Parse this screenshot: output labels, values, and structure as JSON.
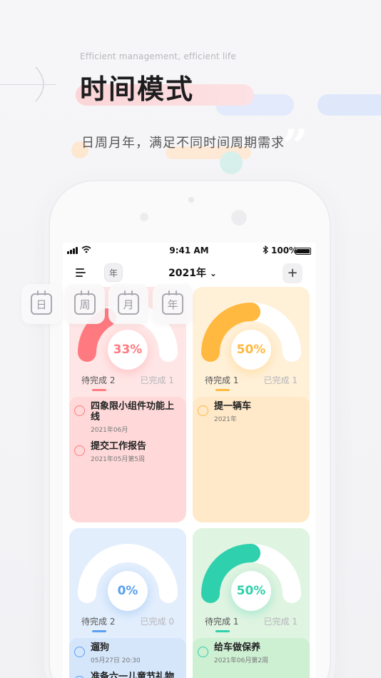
{
  "header": {
    "tagline": "Efficient management, efficient life",
    "title": "时间模式",
    "subtitle": "日周月年，满足不同时间周期需求",
    "quote_mark": "”"
  },
  "status_bar": {
    "time": "9:41 AM",
    "battery": "100%"
  },
  "app_bar": {
    "calendar_badge": "年",
    "year": "2021年",
    "year_chevron": "⌄",
    "add_label": "+"
  },
  "mode_chips": [
    {
      "label": "日"
    },
    {
      "label": "周"
    },
    {
      "label": "月"
    },
    {
      "label": "年"
    }
  ],
  "cards": [
    {
      "percent": "33%",
      "percent_value": 0.33,
      "color": "#ff7a80",
      "track": "#ffffff",
      "pending": "待完成 2",
      "done": "已完成 1",
      "tasks": [
        {
          "name": "四象限小组件功能上线",
          "date": "2021年06月"
        },
        {
          "name": "提交工作报告",
          "date": "2021年05月第5周"
        }
      ]
    },
    {
      "percent": "50%",
      "percent_value": 0.5,
      "color": "#ffb940",
      "track": "#ffffff",
      "pending": "待完成 1",
      "done": "已完成 1",
      "tasks": [
        {
          "name": "提一辆车",
          "date": "2021年"
        }
      ]
    },
    {
      "percent": "0%",
      "percent_value": 0,
      "color": "#5aa0ee",
      "track": "#ffffff",
      "pending": "待完成 2",
      "done": "已完成 0",
      "tasks": [
        {
          "name": "遛狗",
          "date": "05月27日 20:30"
        },
        {
          "name": "准备六一儿童节礼物",
          "date": ""
        }
      ]
    },
    {
      "percent": "50%",
      "percent_value": 0.5,
      "color": "#2fd0ad",
      "track": "#ffffff",
      "pending": "待完成 1",
      "done": "已完成 1",
      "tasks": [
        {
          "name": "给车做保养",
          "date": "2021年06月第2周"
        }
      ]
    }
  ],
  "colors": {
    "c1_list": "#ffd9d9",
    "c2_list": "#ffe9c8",
    "c3_list": "#d5e6fb",
    "c4_list": "#cdefd2"
  }
}
